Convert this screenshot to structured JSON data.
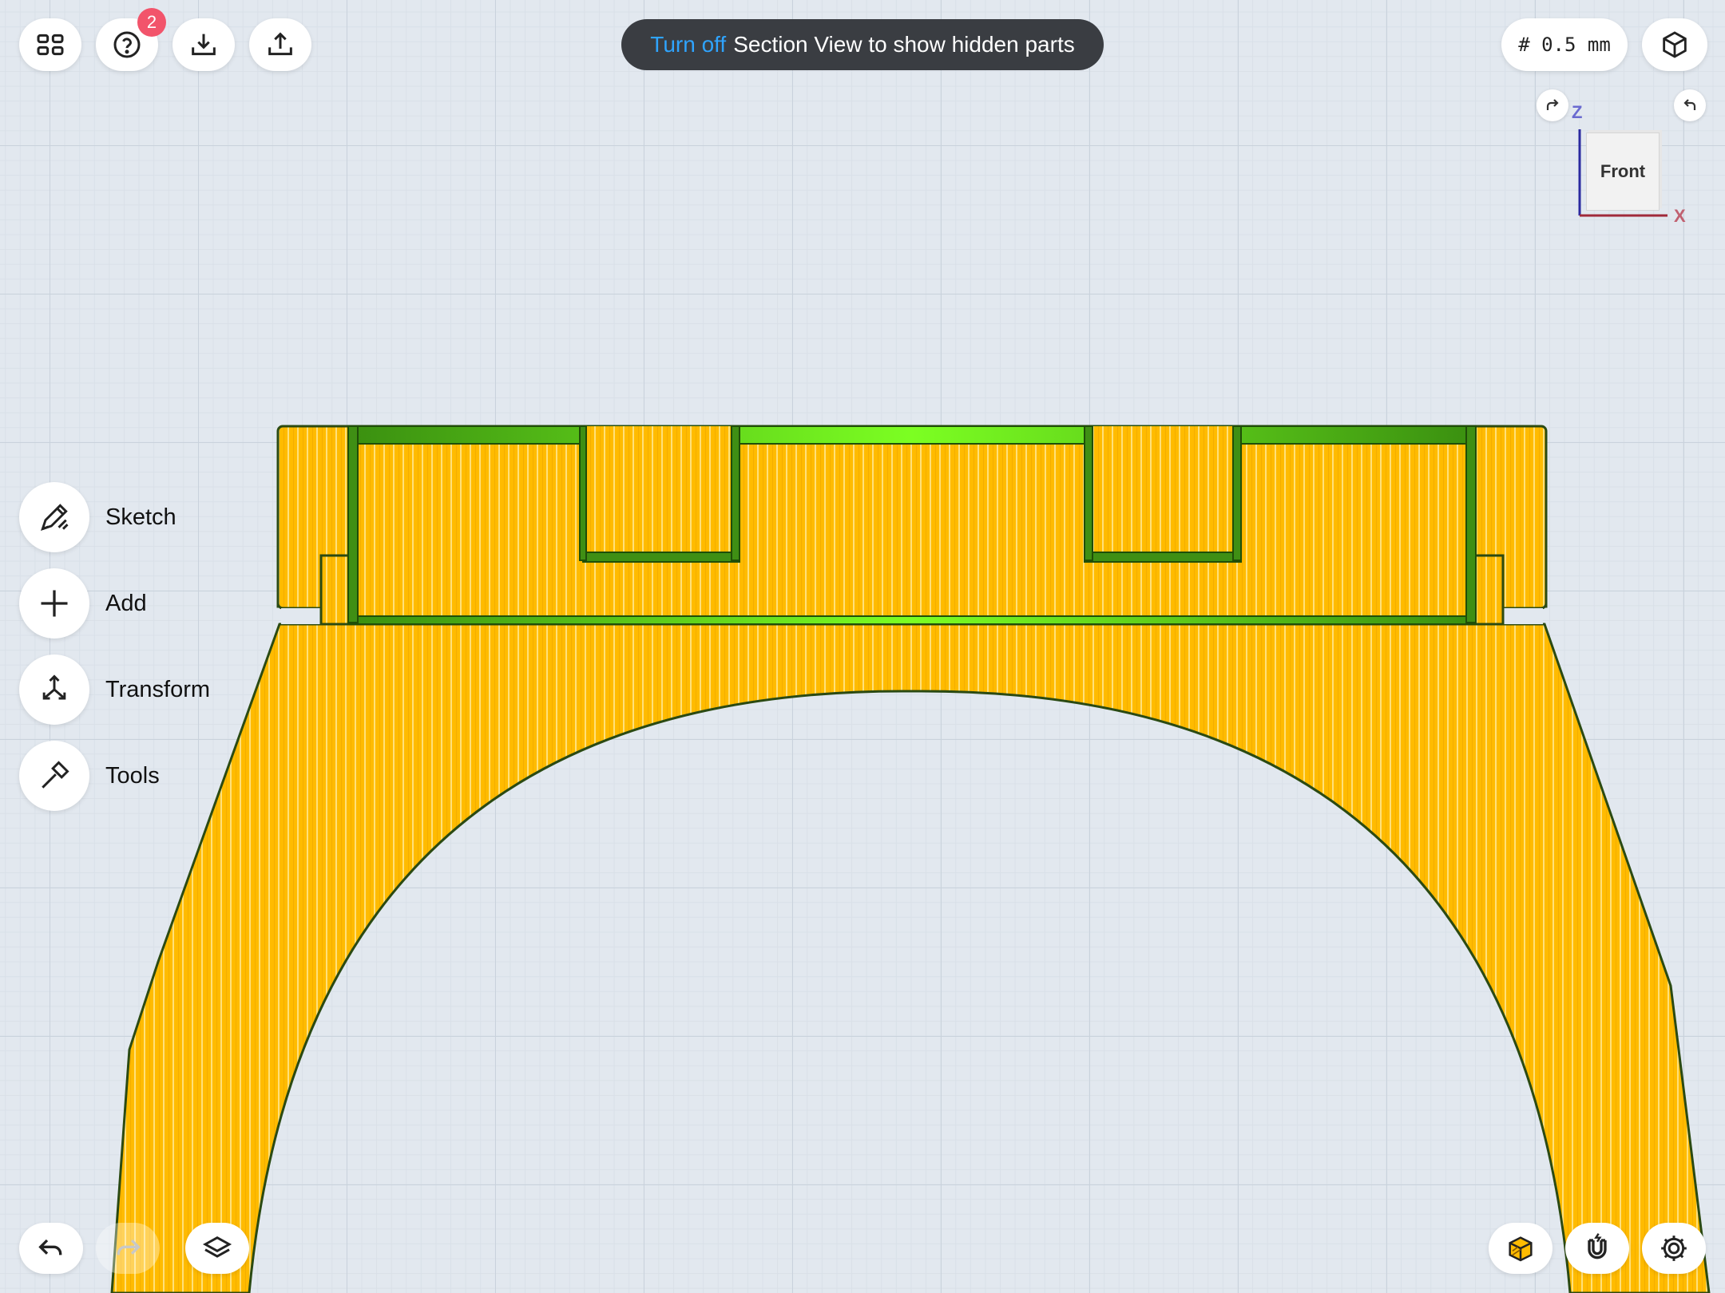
{
  "toolbar": {
    "help_badge": "2",
    "section_toast": {
      "link": "Turn off",
      "message": "Section View to show hidden parts"
    },
    "grid_size": "# 0.5 mm"
  },
  "sidebar": {
    "items": [
      {
        "label": "Sketch",
        "icon": "pencil-icon"
      },
      {
        "label": "Add",
        "icon": "plus-icon"
      },
      {
        "label": "Transform",
        "icon": "transform-icon"
      },
      {
        "label": "Tools",
        "icon": "hammer-icon"
      }
    ]
  },
  "viewcube": {
    "face": "Front",
    "axis_z": "Z",
    "axis_x": "X"
  },
  "colors": {
    "part_fill": "#ffbb00",
    "part_stripe": "#ffe480",
    "section_green": "#6de81a",
    "section_dark": "#2f6e0c",
    "outline": "#2b4a12",
    "toast_link": "#2fa4ff",
    "badge": "#f2546b"
  }
}
